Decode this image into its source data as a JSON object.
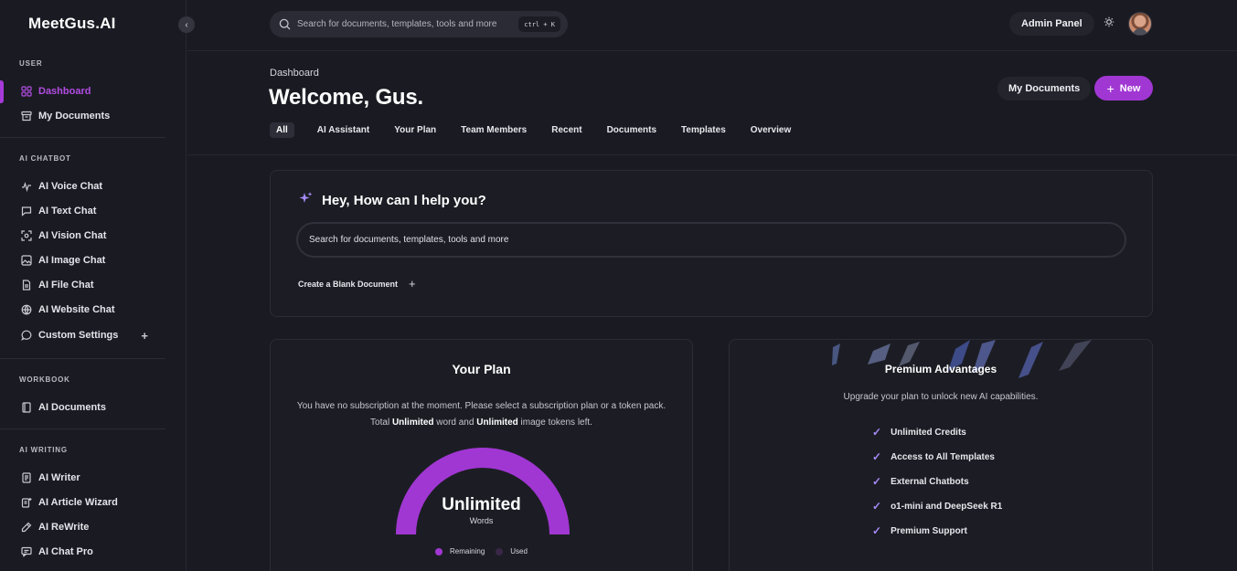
{
  "brand": {
    "logo": "MeetGus.AI"
  },
  "sidebar": {
    "sections": {
      "user": "USER",
      "ai_chatbot": "AI CHATBOT",
      "workbook": "WORKBOOK",
      "ai_writing": "AI WRITING"
    },
    "items": {
      "dashboard": "Dashboard",
      "my_documents": "My Documents",
      "ai_voice_chat": "AI Voice Chat",
      "ai_text_chat": "AI Text Chat",
      "ai_vision_chat": "AI Vision Chat",
      "ai_image_chat": "AI Image Chat",
      "ai_file_chat": "AI File Chat",
      "ai_website_chat": "AI Website Chat",
      "custom_settings": "Custom Settings",
      "ai_documents": "AI Documents",
      "ai_writer": "AI Writer",
      "ai_article_wizard": "AI Article Wizard",
      "ai_rewrite": "AI ReWrite",
      "ai_chat_pro": "AI Chat Pro"
    }
  },
  "topbar": {
    "search_placeholder": "Search for documents, templates, tools and more",
    "shortcut": "ctrl + K",
    "admin_panel": "Admin Panel"
  },
  "header": {
    "breadcrumb": "Dashboard",
    "welcome": "Welcome, Gus.",
    "my_documents": "My Documents",
    "new_label": "New"
  },
  "tabs": [
    "All",
    "AI Assistant",
    "Your Plan",
    "Team Members",
    "Recent",
    "Documents",
    "Templates",
    "Overview"
  ],
  "help": {
    "title": "Hey, How can I help you?",
    "placeholder": "Search for documents, templates, tools and more",
    "blank_doc": "Create a Blank Document"
  },
  "plan": {
    "title": "Your Plan",
    "desc_1": "You have no subscription at the moment. Please select a subscription plan or a token pack. Total ",
    "desc_bold_1": "Unlimited",
    "desc_2": " word and ",
    "desc_bold_2": "Unlimited",
    "desc_3": " image tokens left.",
    "gauge_value": "Unlimited",
    "gauge_unit": "Words",
    "gauge_remaining_fraction": 1.0,
    "legend_remaining": "Remaining",
    "legend_used": "Used"
  },
  "premium": {
    "title": "Premium Advantages",
    "subtitle": "Upgrade your plan to unlock new AI capabilities.",
    "features": [
      "Unlimited Credits",
      "Access to All Templates",
      "External Chatbots",
      "o1-mini and DeepSeek R1",
      "Premium Support"
    ]
  },
  "colors": {
    "accent": "#a137d3",
    "active_nav": "#b24ce3",
    "check": "#a78bfa",
    "background": "#1a1b22",
    "used": "#3a2748"
  },
  "icons": {
    "dashboard": "grid-icon",
    "my_documents": "archive-icon",
    "voice": "waveform-icon",
    "text": "chat-bubble-icon",
    "vision": "scan-icon",
    "image": "image-icon",
    "file": "file-icon",
    "website": "globe-icon",
    "custom": "message-circle-icon",
    "sparkle": "sparkle-icon",
    "theme": "sun-icon"
  }
}
